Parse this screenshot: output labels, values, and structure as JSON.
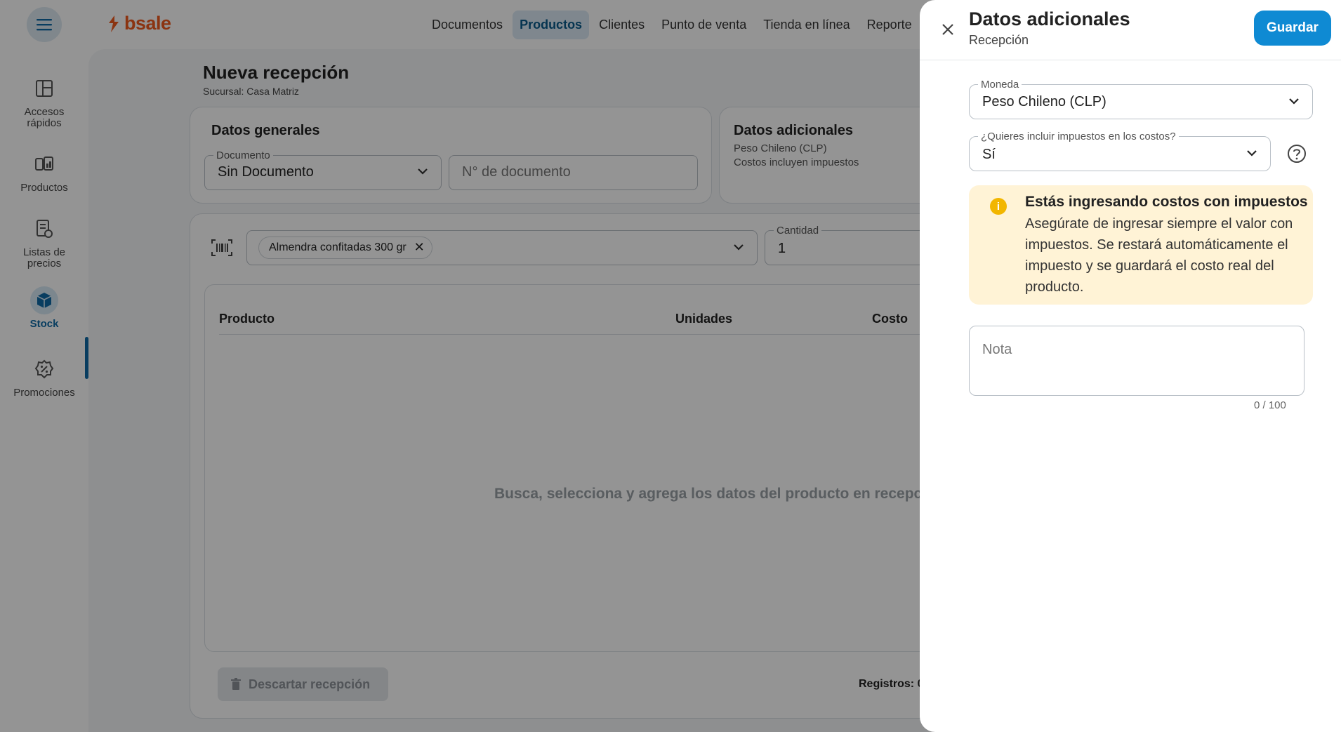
{
  "topbar": {
    "brand": "bsale",
    "nav": [
      "Documentos",
      "Productos",
      "Clientes",
      "Punto de venta",
      "Tienda en línea",
      "Reporte"
    ],
    "active_nav": "Productos"
  },
  "sidebar": {
    "items": [
      {
        "label": "Accesos rápidos",
        "icon": "layout-icon"
      },
      {
        "label": "Productos",
        "icon": "products-icon"
      },
      {
        "label": "Listas de precios",
        "icon": "price-list-icon"
      },
      {
        "label": "Stock",
        "icon": "box-icon"
      },
      {
        "label": "Promociones",
        "icon": "promo-icon"
      }
    ],
    "active": "Stock"
  },
  "page": {
    "title": "Nueva recepción",
    "subtitle": "Sucursal: Casa Matriz"
  },
  "general_card": {
    "title": "Datos generales",
    "document_label": "Documento",
    "document_value": "Sin Documento",
    "doc_number_placeholder": "N° de documento"
  },
  "additional_card": {
    "title": "Datos adicionales",
    "line1": "Peso Chileno (CLP)",
    "line2": "Costos incluyen impuestos"
  },
  "product_search": {
    "chip": "Almendra confitadas 300 gr",
    "chip_remove": "✕",
    "qty_label": "Cantidad",
    "qty_value": "1"
  },
  "table": {
    "headers": [
      "Producto",
      "Unidades",
      "Costo"
    ],
    "empty_message": "Busca, selecciona y agrega los datos del producto en recepci"
  },
  "footer": {
    "discard": "Descartar recepción",
    "records": "Registros: 0"
  },
  "drawer": {
    "title": "Datos adicionales",
    "subtitle": "Recepción",
    "save": "Guardar",
    "currency_label": "Moneda",
    "currency_value": "Peso Chileno (CLP)",
    "tax_label": "¿Quieres incluir impuestos en los costos?",
    "tax_value": "Sí",
    "alert_title": "Estás ingresando costos con impuestos",
    "alert_body": "Asegúrate de ingresar siempre el valor con impuestos. Se restará automáticamente el impuesto y se guardará el costo real del producto.",
    "alert_icon_glyph": "i",
    "note_placeholder": "Nota",
    "note_counter": "0 / 100"
  },
  "colors": {
    "brand": "#f05a1e",
    "primary": "#0f8ad3",
    "active_blue": "#0f6aa5",
    "alert_bg": "#fff3d6",
    "alert_icon": "#f2b600"
  }
}
